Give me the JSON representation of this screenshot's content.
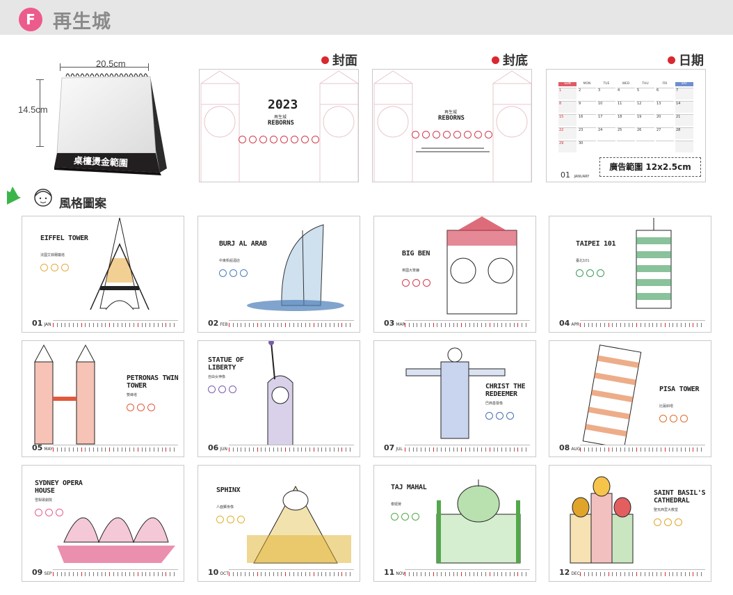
{
  "header": {
    "badge": "F",
    "title": "再生城"
  },
  "product": {
    "width_label": "20.5cm",
    "height_label": "14.5cm",
    "base_text": "桌檯燙金範圍"
  },
  "sections": {
    "cover": "封面",
    "back": "封底",
    "dates": "日期",
    "styles": "風格圖案"
  },
  "cover": {
    "year": "2023",
    "zh": "再生城",
    "en": "REBORNS"
  },
  "back": {
    "zh": "再生城",
    "en": "REBORNS"
  },
  "dates_card": {
    "weekdays": [
      "SUN",
      "MON",
      "TUE",
      "WED",
      "THU",
      "FRI",
      "SAT"
    ],
    "month": "01",
    "month_name": "JANUARY",
    "ad_label": "廣告範圍 12x2.5cm"
  },
  "months": [
    {
      "num": "01",
      "abbr": "JAN",
      "title": "EIFFEL TOWER",
      "sub": "法國艾菲爾鐵塔",
      "accent": "#e8a93a"
    },
    {
      "num": "02",
      "abbr": "FEB",
      "title": "BURJ AL ARAB",
      "sub": "中東帆船酒店",
      "accent": "#4a7db8"
    },
    {
      "num": "03",
      "abbr": "MAR",
      "title": "BIG BEN",
      "sub": "英國大笨鐘",
      "accent": "#d23b4e"
    },
    {
      "num": "04",
      "abbr": "APR",
      "title": "TAIPEI 101",
      "sub": "臺北101",
      "accent": "#3c9a5a"
    },
    {
      "num": "05",
      "abbr": "MAY",
      "title": "PETRONAS TWIN TOWER",
      "sub": "雙峰塔",
      "accent": "#e2593c"
    },
    {
      "num": "06",
      "abbr": "JUN",
      "title": "STATUE OF LIBERTY",
      "sub": "自由女神像",
      "accent": "#7a5bb0"
    },
    {
      "num": "07",
      "abbr": "JUL",
      "title": "CHRIST THE REDEEMER",
      "sub": "巴西基督像",
      "accent": "#4a6cb5"
    },
    {
      "num": "08",
      "abbr": "AUG",
      "title": "PISA TOWER",
      "sub": "比薩斜塔",
      "accent": "#e06b2a"
    },
    {
      "num": "09",
      "abbr": "SEP",
      "title": "SYDNEY OPERA HOUSE",
      "sub": "雪梨歌劇院",
      "accent": "#e35f8c"
    },
    {
      "num": "10",
      "abbr": "OCT",
      "title": "SPHINX",
      "sub": "人面獅身像",
      "accent": "#e0b02a"
    },
    {
      "num": "11",
      "abbr": "NOV",
      "title": "TAJ MAHAL",
      "sub": "泰姬陵",
      "accent": "#52a84a"
    },
    {
      "num": "12",
      "abbr": "DEC",
      "title": "SAINT BASIL'S CATHEDRAL",
      "sub": "聖瓦西里大教堂",
      "accent": "#e0a42a"
    }
  ]
}
